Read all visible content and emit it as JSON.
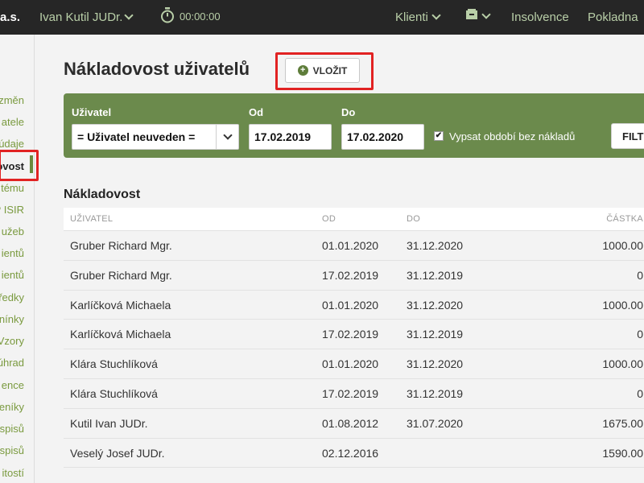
{
  "topbar": {
    "brand": "a.s.",
    "user": "Ivan Kutil JUDr.",
    "timer": "00:00:00",
    "nav": [
      {
        "label": "Klienti",
        "has_dropdown": true
      },
      {
        "label": "",
        "icon": "box-icon",
        "has_dropdown": true
      },
      {
        "label": "Insolvence",
        "has_dropdown": false
      },
      {
        "label": "Pokladna",
        "has_dropdown": false
      }
    ]
  },
  "sidebar": {
    "items": [
      {
        "label": "změn"
      },
      {
        "label": "atele"
      },
      {
        "label": "údaje"
      },
      {
        "label": "ovost",
        "active": true
      },
      {
        "label": "tému"
      },
      {
        "label": "P ISIR"
      },
      {
        "label": "užeb"
      },
      {
        "label": "ientů"
      },
      {
        "label": "ientů"
      },
      {
        "label": "ředky"
      },
      {
        "label": "nínky"
      },
      {
        "label": "Vzory"
      },
      {
        "label": "úhrad"
      },
      {
        "label": "ence"
      },
      {
        "label": "eníky"
      },
      {
        "label": "spisů"
      },
      {
        "label": "spisů"
      },
      {
        "label": "itostí"
      }
    ]
  },
  "page": {
    "title": "Nákladovost uživatelů",
    "insert_button": "VLOŽIT"
  },
  "filter": {
    "user_label": "Uživatel",
    "user_value": "= Uživatel neuveden =",
    "from_label": "Od",
    "from_value": "17.02.2019",
    "to_label": "Do",
    "to_value": "17.02.2020",
    "checkbox_label": "Vypsat období bez nákladů",
    "checkbox_checked": true,
    "filter_button": "FILT"
  },
  "table": {
    "title": "Nákladovost",
    "columns": [
      "UŽIVATEL",
      "OD",
      "DO",
      "ČÁSTKA"
    ],
    "rows": [
      [
        "Gruber Richard Mgr.",
        "01.01.2020",
        "31.12.2020",
        "1000.00"
      ],
      [
        "Gruber Richard Mgr.",
        "17.02.2019",
        "31.12.2019",
        "0"
      ],
      [
        "Karlíčková Michaela",
        "01.01.2020",
        "31.12.2020",
        "1000.00"
      ],
      [
        "Karlíčková Michaela",
        "17.02.2019",
        "31.12.2019",
        "0"
      ],
      [
        "Klára Stuchlíková",
        "01.01.2020",
        "31.12.2020",
        "1000.00"
      ],
      [
        "Klára Stuchlíková",
        "17.02.2019",
        "31.12.2019",
        "0"
      ],
      [
        "Kutil Ivan JUDr.",
        "01.08.2012",
        "31.07.2020",
        "1675.00"
      ],
      [
        "Veselý Josef JUDr.",
        "02.12.2016",
        "",
        "1590.00"
      ]
    ]
  },
  "colors": {
    "topbar_bg": "#262626",
    "accent_green": "#6b8a4c",
    "highlight_red": "#e12222",
    "link_green": "#7a9a3f"
  }
}
